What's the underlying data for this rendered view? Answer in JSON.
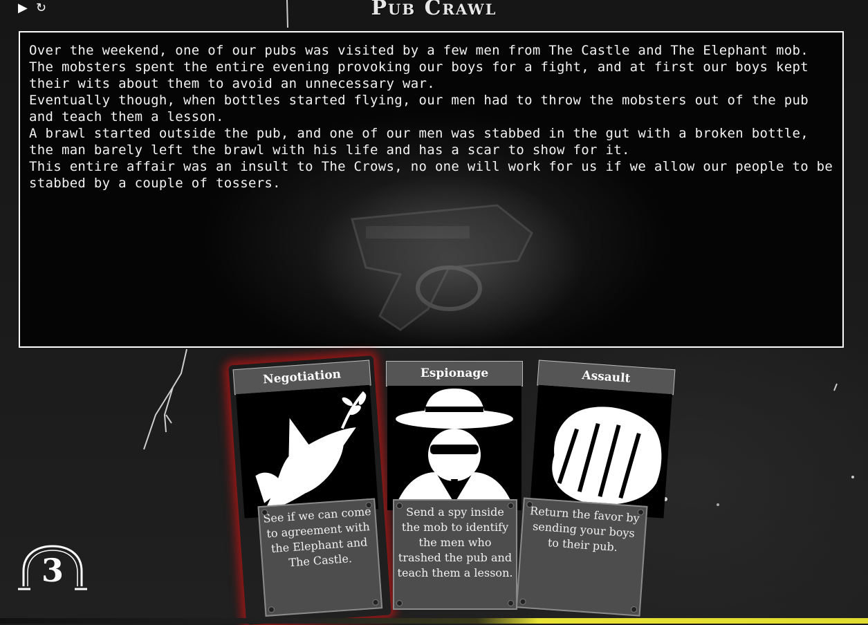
{
  "controls": {
    "play_icon": "▶",
    "restart_icon": "↻"
  },
  "title": "Pub Crawl",
  "story": {
    "paragraphs": [
      "Over the weekend, one of our pubs was visited by a few men from The Castle and The Elephant mob.",
      "The mobsters spent the entire evening provoking our boys for a fight, and at first our boys kept their wits about them to avoid an unnecessary war.",
      "Eventually though, when bottles started flying, our men had to throw the mobsters out of the pub and teach them a lesson.",
      "A brawl started outside the pub, and one of our men was stabbed in the gut with a broken bottle, the man barely left the brawl with his life and has a scar to show for it.",
      "This entire affair was an insult to The Crows, no one will work for us if we allow our people to be stabbed by a couple of tossers."
    ]
  },
  "cards": [
    {
      "name": "Negotiation",
      "icon": "dove-icon",
      "description": "See if we can come to agreement with the Elephant and The Castle.",
      "selected": true
    },
    {
      "name": "Espionage",
      "icon": "spy-icon",
      "description": "Send a spy inside the mob to identify the men who trashed the pub and teach them a lesson.",
      "selected": false
    },
    {
      "name": "Assault",
      "icon": "fist-icon",
      "description": "Return the favor by sending your boys to their pub.",
      "selected": false
    }
  ],
  "round": {
    "number": "3"
  },
  "colors": {
    "selected_glow": "#c81414",
    "accent_yellow": "#e7e234"
  }
}
